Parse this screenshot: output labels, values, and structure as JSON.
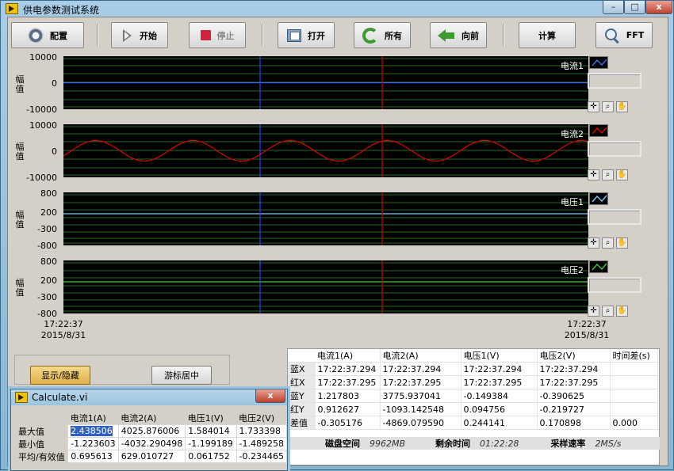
{
  "window": {
    "title": "供电参数测试系统",
    "minimize": "–",
    "maximize": "□",
    "close": "x"
  },
  "toolbar": {
    "config": "配置",
    "start": "开始",
    "stop": "停止",
    "open": "打开",
    "all": "所有",
    "forward": "向前",
    "compute": "计算",
    "fft": "FFT"
  },
  "plots": [
    {
      "name": "电流1",
      "ylabel": "幅值",
      "yticks": [
        "10000",
        "0",
        "-10000"
      ],
      "color": "#3d6cff"
    },
    {
      "name": "电流2",
      "ylabel": "幅值",
      "yticks": [
        "10000",
        "0",
        "-10000"
      ],
      "color": "#e00000"
    },
    {
      "name": "电压1",
      "ylabel": "幅值",
      "yticks": [
        "800",
        "200",
        "-300",
        "-800"
      ],
      "color": "#7ec8ff"
    },
    {
      "name": "电压2",
      "ylabel": "幅值",
      "yticks": [
        "800",
        "200",
        "-300",
        "-800"
      ],
      "color": "#3fcf3f"
    }
  ],
  "xaxis": {
    "start_time": "17:22:37",
    "start_date": "2015/8/31",
    "end_time": "17:22:37",
    "end_date": "2015/8/31"
  },
  "controls": {
    "show_hide": "显示/隐藏",
    "center_cursor": "游标居中"
  },
  "cursor_table": {
    "headers": [
      "",
      "电流1(A)",
      "电流2(A)",
      "电压1(V)",
      "电压2(V)",
      "时间差(s)"
    ],
    "rows": [
      [
        "蓝X",
        "17:22:37.294",
        "17:22:37.294",
        "17:22:37.294",
        "17:22:37.294",
        ""
      ],
      [
        "红X",
        "17:22:37.295",
        "17:22:37.295",
        "17:22:37.295",
        "17:22:37.295",
        ""
      ],
      [
        "蓝Y",
        "1.217803",
        "3775.937041",
        "-0.149384",
        "-0.390625",
        ""
      ],
      [
        "红Y",
        "0.912627",
        "-1093.142548",
        "0.094756",
        "-0.219727",
        ""
      ],
      [
        "差值",
        "-0.305176",
        "-4869.079590",
        "0.244141",
        "0.170898",
        "0.000"
      ]
    ]
  },
  "status": {
    "disk_label": "磁盘空间",
    "disk_value": "9962MB",
    "remain_label": "剩余时间",
    "remain_value": "01:22:28",
    "rate_label": "采样速率",
    "rate_value": "2MS/s"
  },
  "calc_window": {
    "title": "Calculate.vi",
    "headers": [
      "",
      "电流1(A)",
      "电流2(A)",
      "电压1(V)",
      "电压2(V)"
    ],
    "rows": [
      [
        "最大值",
        "2.438506",
        "4025.876006",
        "1.584014",
        "1.733398"
      ],
      [
        "最小值",
        "-1.223603",
        "-4032.290498",
        "-1.199189",
        "-1.489258"
      ],
      [
        "平均/有效值",
        "0.695613",
        "629.010727",
        "0.061752",
        "-0.234465"
      ]
    ]
  }
}
